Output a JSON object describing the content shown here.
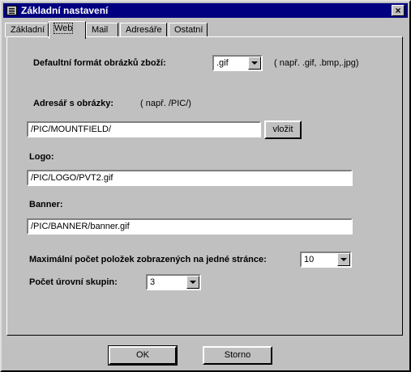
{
  "window": {
    "title": "Základní nastavení",
    "close_label": "×"
  },
  "tabs": [
    {
      "label": "Základní"
    },
    {
      "label": "Web"
    },
    {
      "label": "Mail"
    },
    {
      "label": "Adresáře"
    },
    {
      "label": "Ostatní"
    }
  ],
  "web": {
    "image_format": {
      "label": "Defaultní formát obrázků zboží:",
      "value": ".gif",
      "hint": "( např. .gif, .bmp,.jpg)"
    },
    "image_dir": {
      "label": "Adresář s obrázky:",
      "hint": "( např. /PIC/)",
      "value": "/PIC/MOUNTFIELD/",
      "insert_button": "vložit"
    },
    "logo": {
      "label": "Logo:",
      "value": "/PIC/LOGO/PVT2.gif"
    },
    "banner": {
      "label": "Banner:",
      "value": "/PIC/BANNER/banner.gif"
    },
    "max_items": {
      "label": "Maximální počet položek zobrazených na jedné stránce:",
      "value": "10"
    },
    "group_levels": {
      "label": "Počet úrovní skupin:",
      "value": "3"
    }
  },
  "footer": {
    "ok_label": "OK",
    "cancel_label": "Storno"
  }
}
